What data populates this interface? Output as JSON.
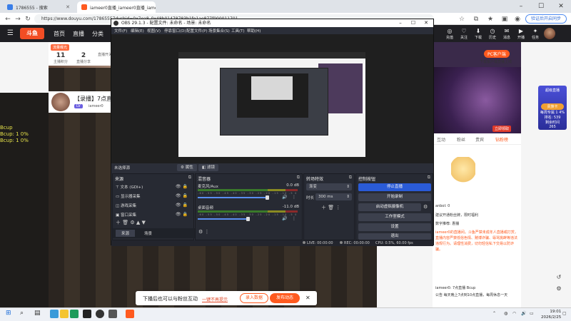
{
  "browser": {
    "tabs": [
      {
        "title": "1786555 - 搜索"
      },
      {
        "title": "iameer0直播_iameer0直播_iameer..."
      },
      {
        "title": "OBS Studio"
      }
    ],
    "url": "https://www.douyu.com/17865557dyshid=0x7ea8_0x48b01478783b1fe1ae877f000011701",
    "sync_button": "验证后开启同步"
  },
  "site": {
    "nav": [
      "首页",
      "直播",
      "分类"
    ],
    "header_icons": [
      {
        "icon": "recharge-icon",
        "label": "充值"
      },
      {
        "icon": "follow-icon",
        "label": "关注"
      },
      {
        "icon": "download-icon",
        "label": "下载"
      },
      {
        "icon": "history-icon",
        "label": "历史"
      },
      {
        "icon": "message-icon",
        "label": "消息"
      },
      {
        "icon": "broadcast-icon",
        "label": "开播"
      },
      {
        "icon": "task-icon",
        "label": "任务"
      }
    ],
    "left_panel": {
      "badge": "流量曝光",
      "stats": [
        {
          "value": "11",
          "label": "主播积分"
        },
        {
          "value": "2",
          "label": "直播分享"
        },
        {
          "value": "",
          "label": "直播开关"
        }
      ]
    },
    "room_title": "【录播】7点直播 ",
    "level_badge": "LV",
    "anchor_name": "iameer0",
    "overlay_text": [
      "Bcup",
      "Bcup: 1 0%",
      "Bcup: 1 0%"
    ],
    "pc_badge": "PC客户端",
    "pc_sub": "下载客户端直播上线",
    "game_button": "立即领取",
    "side_card": {
      "title": "超级直播",
      "rank": "贵族卡",
      "line1": "每周专属 1 4%",
      "line2": "排名: 539",
      "line3": "剩余时间",
      "line4": "265"
    },
    "chat_tabs": [
      "互动",
      "粉丝",
      "贵宾",
      "钻粉榜"
    ],
    "chat_lines": [
      "anbol: 0",
      "建议开通粉丝牌，限时福利",
      "数字推荐: 惠播",
      "iameer0: 7点直播 Bcup",
      "公告 每天晚上7点到10点直播，每周休息一天"
    ],
    "notice": "iameer0的直播间。斗鱼严禁未成年人直播或打赏，直播内容严禁低俗色情、赌博诈骗、辱骂挑衅等违法违规行为。请理性消费，切勿轻信私下交易以防诈骗。",
    "bottom_bar": {
      "text": "下播后也可以与粉丝互动",
      "link": "一键不再提示",
      "btn1": "录入数据",
      "btn2": "发布动态"
    }
  },
  "obs": {
    "title": "OBS 29.1.3 - 配置文件: 未命名 - 场景: 未命名",
    "menu": [
      "文件(F)",
      "编辑(E)",
      "视图(V)",
      "停靠窗口(D)",
      "配置文件(P)",
      "场景集合(S)",
      "工具(T)",
      "帮助(H)"
    ],
    "source_bar": {
      "label": "未选择源",
      "properties": "属性",
      "filters": "滤镜"
    },
    "sources": {
      "title": "来源",
      "items": [
        "文本 (GDI+)",
        "显示器采集",
        "游戏采集",
        "窗口采集"
      ],
      "tabs": [
        "来源",
        "场景"
      ]
    },
    "mixer": {
      "title": "混音器",
      "channels": [
        {
          "name": "麦克风/Aux",
          "db": "0.0 dB",
          "level": 0.85
        },
        {
          "name": "桌面音频",
          "db": "-11.0 dB",
          "level": 0.62
        }
      ],
      "scale": "-60 -55 -50 -45 -40 -35 -30 -25 -20 -15 -10 -5 0"
    },
    "transitions": {
      "title": "转场特效",
      "type": "渐变",
      "duration_label": "时长",
      "duration": "300 ms"
    },
    "controls": {
      "title": "控制按钮",
      "buttons": [
        "停止直播",
        "开始录制",
        "启动虚拟摄像机",
        "工作室模式",
        "设置",
        "退出"
      ]
    },
    "status": {
      "live": "LIVE: 00:00:00",
      "rec": "REC: 00:00:00",
      "cpu": "CPU: 0.5%, 60.00 fps"
    }
  },
  "taskbar": {
    "time": "19:01",
    "date": "2026/2/25"
  }
}
